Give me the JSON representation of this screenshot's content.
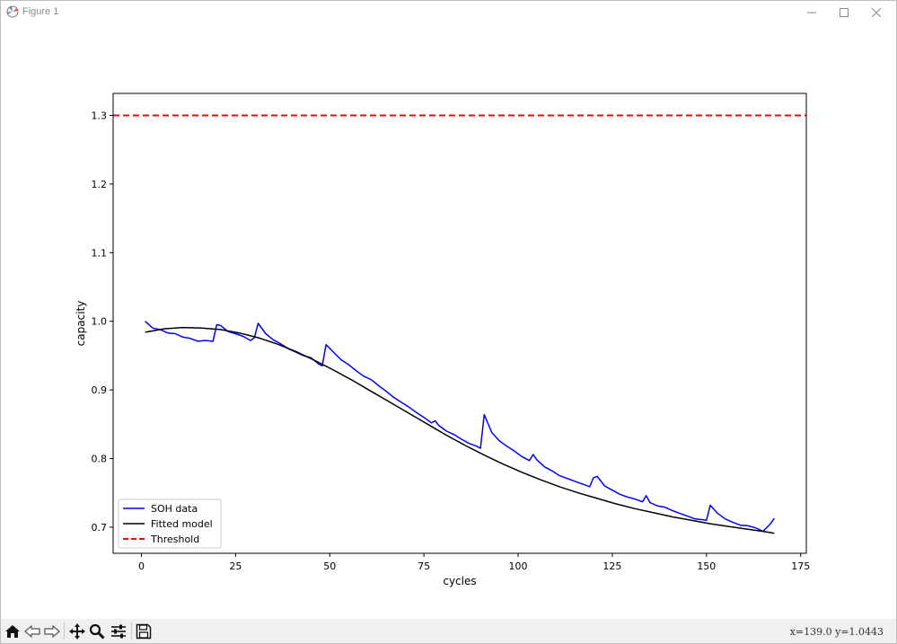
{
  "window": {
    "title": "Figure 1"
  },
  "toolbar": {
    "buttons": [
      "home-icon",
      "back-icon",
      "forward-icon",
      "pan-icon",
      "zoom-icon",
      "configure-subplots-icon",
      "save-icon"
    ],
    "coords": "x=139.0  y=1.0443"
  },
  "colors": {
    "soh": "#0000ff",
    "fitted": "#000000",
    "threshold": "#ff0000"
  },
  "chart_data": {
    "type": "line",
    "title": "",
    "xlabel": "cycles",
    "ylabel": "capacity",
    "xlim": [
      -7.5,
      176.5
    ],
    "ylim": [
      0.662,
      1.332
    ],
    "xticks": [
      0,
      25,
      50,
      75,
      100,
      125,
      150,
      175
    ],
    "yticks": [
      0.7,
      0.8,
      0.9,
      1.0,
      1.1,
      1.2,
      1.3
    ],
    "xtick_labels": [
      "0",
      "25",
      "50",
      "75",
      "100",
      "125",
      "150",
      "175"
    ],
    "ytick_labels": [
      "0.7",
      "0.8",
      "0.9",
      "1.0",
      "1.1",
      "1.2",
      "1.3"
    ],
    "legend_position": "lower-left",
    "grid": false,
    "series": [
      {
        "name": "SOH data",
        "style": "solid",
        "x": [
          1,
          3,
          5,
          7,
          9,
          11,
          13,
          15,
          17,
          19,
          20,
          21,
          23,
          25,
          27,
          29,
          30,
          31,
          33,
          35,
          37,
          39,
          41,
          43,
          45,
          47,
          48,
          49,
          51,
          53,
          55,
          57,
          59,
          61,
          63,
          65,
          67,
          69,
          71,
          73,
          75,
          77,
          78,
          79,
          81,
          83,
          85,
          87,
          89,
          90,
          91,
          93,
          95,
          97,
          99,
          101,
          103,
          104,
          105,
          107,
          109,
          111,
          113,
          115,
          117,
          119,
          120,
          121,
          123,
          125,
          127,
          129,
          131,
          133,
          134,
          135,
          137,
          139,
          141,
          143,
          145,
          147,
          149,
          150,
          151,
          153,
          155,
          157,
          159,
          161,
          163,
          165,
          167,
          168
        ],
        "values": [
          1.0,
          0.99,
          0.988,
          0.983,
          0.982,
          0.977,
          0.975,
          0.971,
          0.972,
          0.971,
          0.995,
          0.994,
          0.985,
          0.982,
          0.978,
          0.972,
          0.976,
          0.997,
          0.982,
          0.973,
          0.967,
          0.96,
          0.955,
          0.95,
          0.947,
          0.938,
          0.935,
          0.966,
          0.955,
          0.944,
          0.937,
          0.928,
          0.92,
          0.915,
          0.906,
          0.898,
          0.889,
          0.882,
          0.875,
          0.867,
          0.86,
          0.852,
          0.855,
          0.848,
          0.84,
          0.835,
          0.828,
          0.822,
          0.818,
          0.815,
          0.864,
          0.838,
          0.826,
          0.818,
          0.811,
          0.803,
          0.797,
          0.806,
          0.798,
          0.788,
          0.782,
          0.775,
          0.771,
          0.767,
          0.763,
          0.759,
          0.772,
          0.774,
          0.76,
          0.754,
          0.748,
          0.744,
          0.741,
          0.737,
          0.746,
          0.736,
          0.731,
          0.729,
          0.724,
          0.72,
          0.716,
          0.712,
          0.711,
          0.71,
          0.732,
          0.72,
          0.712,
          0.707,
          0.703,
          0.702,
          0.699,
          0.694,
          0.705,
          0.713
        ]
      },
      {
        "name": "Fitted model",
        "style": "solid",
        "x": [
          1,
          6,
          11,
          16,
          21,
          26,
          31,
          36,
          41,
          46,
          51,
          56,
          61,
          66,
          71,
          76,
          81,
          86,
          91,
          96,
          101,
          106,
          111,
          116,
          121,
          126,
          131,
          136,
          141,
          146,
          151,
          156,
          161,
          166,
          168
        ],
        "values": [
          0.984,
          0.989,
          0.991,
          0.99,
          0.988,
          0.983,
          0.976,
          0.967,
          0.956,
          0.943,
          0.929,
          0.914,
          0.898,
          0.882,
          0.866,
          0.85,
          0.834,
          0.819,
          0.805,
          0.792,
          0.78,
          0.769,
          0.759,
          0.75,
          0.742,
          0.734,
          0.727,
          0.721,
          0.715,
          0.71,
          0.705,
          0.701,
          0.697,
          0.693,
          0.691
        ]
      },
      {
        "name": "Threshold",
        "style": "dashed",
        "values": [
          1.3
        ]
      }
    ]
  }
}
